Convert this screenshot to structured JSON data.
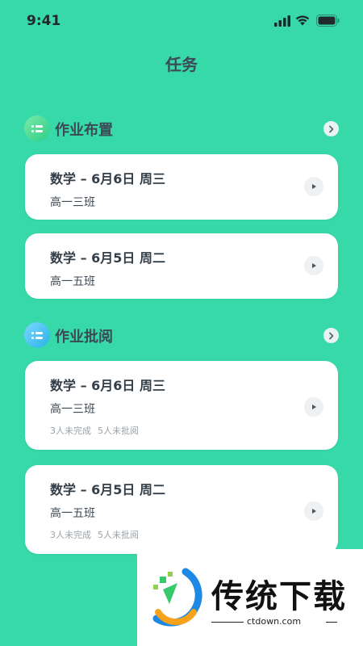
{
  "status_bar": {
    "time": "9:41"
  },
  "header": {
    "title": "任务"
  },
  "sections": [
    {
      "title": "作业布置",
      "cards": [
        {
          "title": "数学 – 6月6日 周三",
          "class_name": "高一三班"
        },
        {
          "title": "数学 – 6月5日 周二",
          "class_name": "高一五班"
        }
      ]
    },
    {
      "title": "作业批阅",
      "cards": [
        {
          "title": "数学 – 6月6日 周三",
          "class_name": "高一三班",
          "incomplete": "3人未完成",
          "unreviewed": "5人未批阅"
        },
        {
          "title": "数学 – 6月5日 周二",
          "class_name": "高一五班",
          "incomplete": "3人未完成",
          "unreviewed": "5人未批阅"
        }
      ]
    }
  ],
  "watermark": {
    "brand": "传统下载",
    "domain": "ctdown.com"
  },
  "icons": {
    "status": [
      "signal-icon",
      "wifi-icon",
      "battery-icon"
    ],
    "section_assign": "list-icon",
    "section_review": "list-icon",
    "section_more": "chevron-right-icon",
    "card_action": "play-icon"
  },
  "colors": {
    "background": "#37d9a9",
    "card": "#ffffff",
    "title_text": "#3b4a56",
    "muted_text": "#9aa3aa",
    "assign_icon": "#2dcf8a",
    "review_icon": "#27b4e6"
  }
}
